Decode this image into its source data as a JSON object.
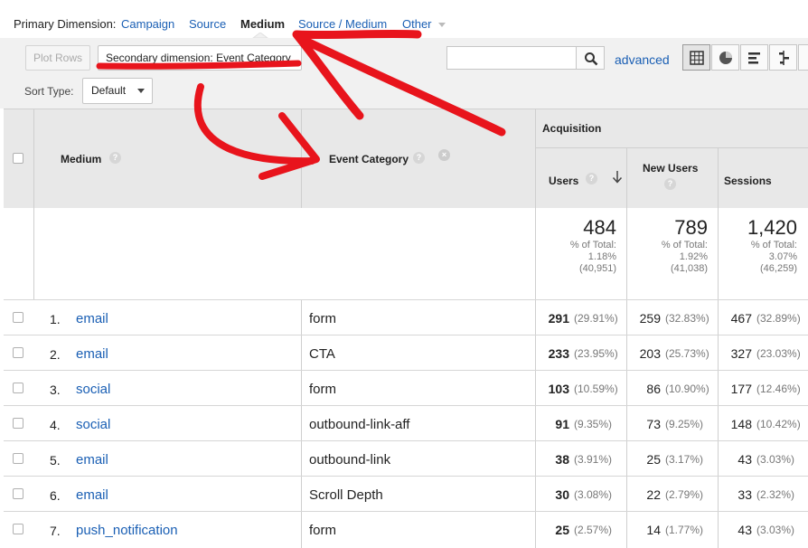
{
  "primary": {
    "label": "Primary Dimension:",
    "options": [
      "Campaign",
      "Source",
      "Medium",
      "Source / Medium",
      "Other"
    ]
  },
  "toolbar": {
    "plot_rows": "Plot Rows",
    "secondary_dimension": "Secondary dimension: Event Category",
    "search_placeholder": "",
    "advanced": "advanced",
    "sort_label": "Sort Type:",
    "sort_value": "Default"
  },
  "table": {
    "acquisition_label": "Acquisition",
    "columns": {
      "medium": "Medium",
      "event_category": "Event Category",
      "users": "Users",
      "new_users": "New Users",
      "sessions": "Sessions"
    },
    "totals": {
      "users": {
        "value": "484",
        "pct_label": "% of Total:",
        "pct": "1.18%",
        "total": "(40,951)"
      },
      "new_users": {
        "value": "789",
        "pct_label": "% of Total:",
        "pct": "1.92%",
        "total": "(41,038)"
      },
      "sessions": {
        "value": "1,420",
        "pct_label": "% of Total:",
        "pct": "3.07%",
        "total": "(46,259)"
      }
    },
    "rows": [
      {
        "num": "1.",
        "medium": "email",
        "category": "form",
        "users": "291",
        "users_pct": "(29.91%)",
        "new_users": "259",
        "new_users_pct": "(32.83%)",
        "sessions": "467",
        "sessions_pct": "(32.89%)"
      },
      {
        "num": "2.",
        "medium": "email",
        "category": "CTA",
        "users": "233",
        "users_pct": "(23.95%)",
        "new_users": "203",
        "new_users_pct": "(25.73%)",
        "sessions": "327",
        "sessions_pct": "(23.03%)"
      },
      {
        "num": "3.",
        "medium": "social",
        "category": "form",
        "users": "103",
        "users_pct": "(10.59%)",
        "new_users": "86",
        "new_users_pct": "(10.90%)",
        "sessions": "177",
        "sessions_pct": "(12.46%)"
      },
      {
        "num": "4.",
        "medium": "social",
        "category": "outbound-link-aff",
        "users": "91",
        "users_pct": "(9.35%)",
        "new_users": "73",
        "new_users_pct": "(9.25%)",
        "sessions": "148",
        "sessions_pct": "(10.42%)"
      },
      {
        "num": "5.",
        "medium": "email",
        "category": "outbound-link",
        "users": "38",
        "users_pct": "(3.91%)",
        "new_users": "25",
        "new_users_pct": "(3.17%)",
        "sessions": "43",
        "sessions_pct": "(3.03%)"
      },
      {
        "num": "6.",
        "medium": "email",
        "category": "Scroll Depth",
        "users": "30",
        "users_pct": "(3.08%)",
        "new_users": "22",
        "new_users_pct": "(2.79%)",
        "sessions": "33",
        "sessions_pct": "(2.32%)"
      },
      {
        "num": "7.",
        "medium": "push_notification",
        "category": "form",
        "users": "25",
        "users_pct": "(2.57%)",
        "new_users": "14",
        "new_users_pct": "(1.77%)",
        "sessions": "43",
        "sessions_pct": "(3.03%)"
      }
    ]
  },
  "colors": {
    "link": "#1a5fb4",
    "annotation": "#e8141c",
    "header_bg": "#e8e8e8",
    "toolbar_bg": "#f1f1f1"
  },
  "icons": [
    "search-icon",
    "table-view-icon",
    "pie-view-icon",
    "bar-view-icon",
    "comparison-view-icon",
    "help-icon",
    "sort-desc-icon",
    "remove-dimension-icon",
    "caret-down-icon"
  ]
}
